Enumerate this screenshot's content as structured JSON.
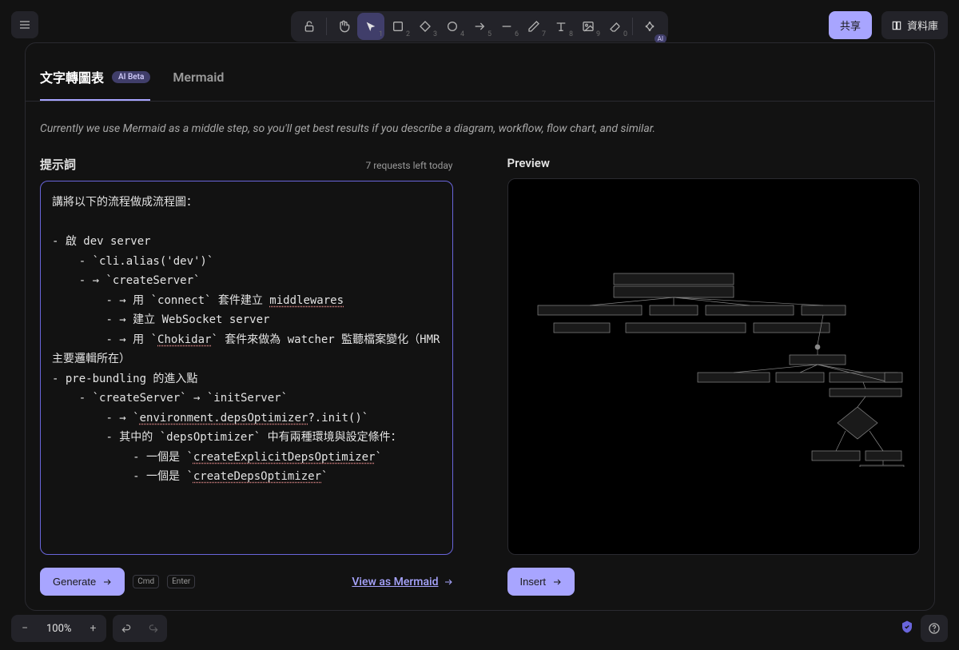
{
  "header": {
    "share_label": "共享",
    "library_label": "資料庫"
  },
  "toolbar": {
    "items": [
      {
        "name": "lock-icon",
        "sub": ""
      },
      {
        "name": "hand-icon",
        "sub": ""
      },
      {
        "name": "pointer-icon",
        "sub": "1"
      },
      {
        "name": "rectangle-icon",
        "sub": "2"
      },
      {
        "name": "diamond-icon",
        "sub": "3"
      },
      {
        "name": "ellipse-icon",
        "sub": "4"
      },
      {
        "name": "arrow-icon",
        "sub": "5"
      },
      {
        "name": "line-icon",
        "sub": "6"
      },
      {
        "name": "pencil-icon",
        "sub": "7"
      },
      {
        "name": "text-icon",
        "sub": "8"
      },
      {
        "name": "image-icon",
        "sub": "9"
      },
      {
        "name": "eraser-icon",
        "sub": "0"
      },
      {
        "name": "more-icon",
        "sub": ""
      }
    ],
    "ai_badge": "AI"
  },
  "tabs": {
    "text_to_diagram": "文字轉圖表",
    "ai_beta_badge": "AI Beta",
    "mermaid": "Mermaid"
  },
  "hint": "Currently we use Mermaid as a middle step, so you'll get best results if you describe a diagram, workflow, flow chart, and similar.",
  "prompt": {
    "title": "提示詞",
    "quota": "7 requests left today",
    "text_line1": "講將以下的流程做成流程圖：",
    "text_s1": "- 啟 dev server",
    "text_s1a": "    - `cli.alias('dev')`",
    "text_s1b": "    - → `createServer`",
    "text_s1b1_pre": "        - → 用 `connect` 套件建立 ",
    "text_s1b1_u": "middlewares",
    "text_s1b2": "        - → 建立 WebSocket server",
    "text_s1b3_pre": "        - → 用 `",
    "text_s1b3_u": "Chokidar",
    "text_s1b3_post": "` 套件來做為 watcher 監聽檔案變化（HMR 主要邏輯所在）",
    "text_s2": "- pre-bundling 的進入點",
    "text_s2a": "    - `createServer` → `initServer`",
    "text_s2a1_pre": "        - → `",
    "text_s2a1_u": "environment.depsOptimizer",
    "text_s2a1_post": "?.init()`",
    "text_s2a2": "        - 其中的 `depsOptimizer` 中有兩種環境與設定條件：",
    "text_s2a2a_pre": "            - 一個是 `",
    "text_s2a2a_u": "createExplicitDepsOptimizer",
    "text_s2a2a_post": "`",
    "text_s2a2b_pre": "            - 一個是 `",
    "text_s2a2b_u": "createDepsOptimizer",
    "text_s2a2b_post": "`"
  },
  "preview": {
    "title": "Preview"
  },
  "actions": {
    "generate": "Generate",
    "kbd_cmd": "Cmd",
    "kbd_enter": "Enter",
    "view_mermaid": "View as Mermaid",
    "insert": "Insert"
  },
  "bottom": {
    "zoom": "100%"
  }
}
